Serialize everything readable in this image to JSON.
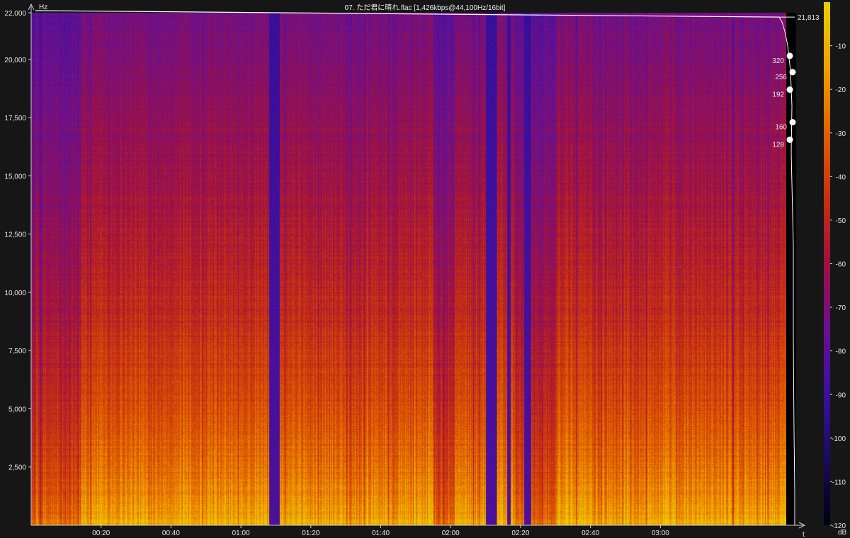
{
  "chart_data": {
    "type": "heatmap",
    "title": "07. ただ君に晴れ.flac [1,426kbps@44,100Hz/16bit]",
    "y_unit_label": "Hz",
    "x_unit_label": "t",
    "colorbar_unit_label": "dB",
    "ylim": [
      0,
      22000
    ],
    "xlim_seconds": [
      0,
      216
    ],
    "y_ticks": [
      {
        "value": 2500,
        "label": "2,500"
      },
      {
        "value": 5000,
        "label": "5,000"
      },
      {
        "value": 7500,
        "label": "7,500"
      },
      {
        "value": 10000,
        "label": "10,000"
      },
      {
        "value": 12500,
        "label": "12,500"
      },
      {
        "value": 15000,
        "label": "15,000"
      },
      {
        "value": 17500,
        "label": "17,500"
      },
      {
        "value": 20000,
        "label": "20,000"
      },
      {
        "value": 22000,
        "label": "22,000"
      }
    ],
    "x_ticks": [
      {
        "value": 20,
        "label": "00:20"
      },
      {
        "value": 40,
        "label": "00:40"
      },
      {
        "value": 60,
        "label": "01:00"
      },
      {
        "value": 80,
        "label": "01:20"
      },
      {
        "value": 100,
        "label": "01:40"
      },
      {
        "value": 120,
        "label": "02:00"
      },
      {
        "value": 140,
        "label": "02:20"
      },
      {
        "value": 160,
        "label": "02:40"
      },
      {
        "value": 180,
        "label": "03:00"
      }
    ],
    "colorbar": {
      "range_db": [
        -120,
        0
      ],
      "ticks": [
        {
          "value": -10,
          "label": "-10"
        },
        {
          "value": -20,
          "label": "-20"
        },
        {
          "value": -30,
          "label": "-30"
        },
        {
          "value": -40,
          "label": "-40"
        },
        {
          "value": -50,
          "label": "-50"
        },
        {
          "value": -60,
          "label": "-60"
        },
        {
          "value": -70,
          "label": "-70"
        },
        {
          "value": -80,
          "label": "-80"
        },
        {
          "value": -90,
          "label": "-90"
        },
        {
          "value": -100,
          "label": "-100"
        },
        {
          "value": -110,
          "label": "-110"
        },
        {
          "value": -120,
          "label": "-120"
        }
      ],
      "colors": [
        "#000010",
        "#1a0a5a",
        "#3a10a0",
        "#6a1090",
        "#a01040",
        "#c83010",
        "#e06000",
        "#f0a000",
        "#e8d000"
      ]
    },
    "cutoff": {
      "value_hz": 21813,
      "label": "21,813"
    },
    "bitrate_markers": [
      {
        "label": "320",
        "freq_hz": 20150
      },
      {
        "label": "256",
        "freq_hz": 19450
      },
      {
        "label": "192",
        "freq_hz": 18700
      },
      {
        "label": "160",
        "freq_hz": 17300
      },
      {
        "label": "128",
        "freq_hz": 16550
      }
    ],
    "quiet_regions_seconds": [
      [
        68,
        71
      ],
      [
        130,
        133
      ],
      [
        136,
        137
      ],
      [
        141,
        143
      ]
    ],
    "dim_regions_seconds": [
      [
        0,
        14
      ],
      [
        115,
        121
      ],
      [
        138,
        150
      ]
    ]
  }
}
